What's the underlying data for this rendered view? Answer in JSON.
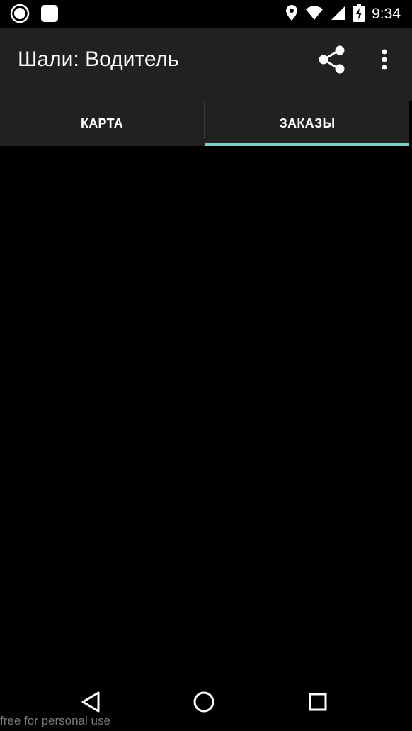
{
  "status_bar": {
    "time": "9:34",
    "icons": [
      "notification-circle-icon",
      "notification-square-icon",
      "location-icon",
      "wifi-icon",
      "signal-icon",
      "battery-charging-icon"
    ]
  },
  "app_bar": {
    "title": "Шали: Водитель",
    "actions": [
      "share-icon",
      "more-vert-icon"
    ]
  },
  "tabs": [
    {
      "label": "КАРТА",
      "selected": false
    },
    {
      "label": "ЗАКАЗЫ",
      "selected": true
    }
  ],
  "colors": {
    "app_bar": "#212121",
    "tab_indicator": "#7ecdc4",
    "background": "#000000"
  },
  "nav_bar": {
    "buttons": [
      "back-icon",
      "home-icon",
      "recent-apps-icon"
    ]
  },
  "watermark": "free for personal use"
}
